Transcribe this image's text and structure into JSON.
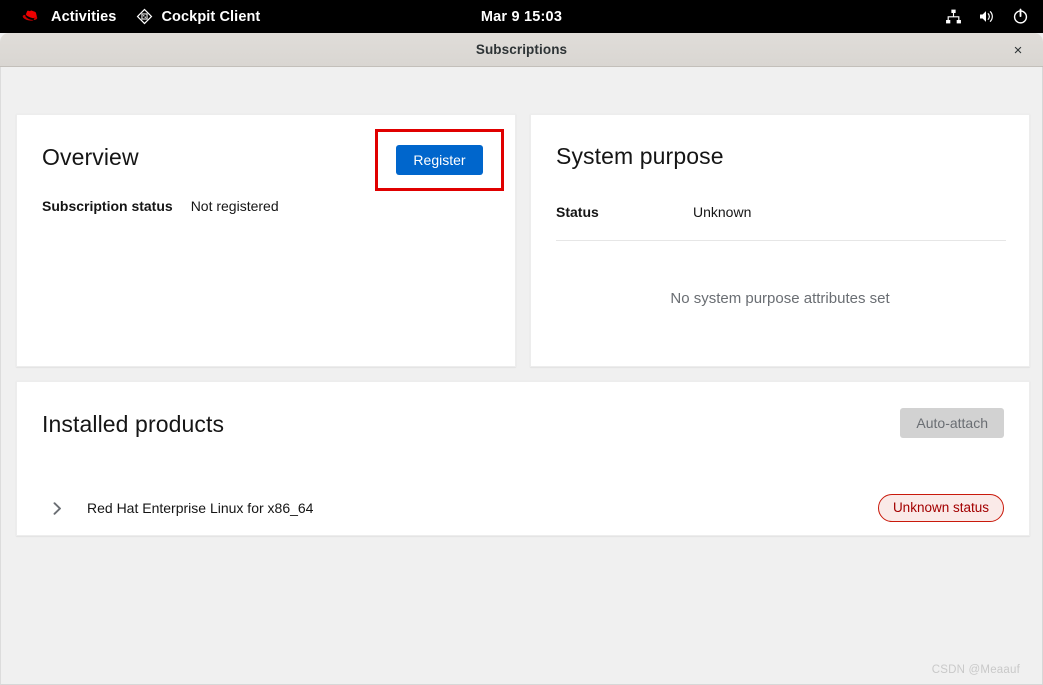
{
  "topbar": {
    "activities_label": "Activities",
    "activities_icon": "red-hat-logo-icon",
    "app_label": "Cockpit Client",
    "app_icon": "cockpit-logo-icon",
    "clock": "Mar 9  15:03",
    "tray": [
      {
        "name": "network-icon"
      },
      {
        "name": "volume-icon"
      },
      {
        "name": "power-icon"
      }
    ]
  },
  "window": {
    "title": "Subscriptions",
    "close_label": "×"
  },
  "overview": {
    "title": "Overview",
    "status_label": "Subscription status",
    "status_value": "Not registered",
    "register_label": "Register",
    "highlight_color": "#e00000",
    "primary_color": "#0066cc"
  },
  "system_purpose": {
    "title": "System purpose",
    "status_label": "Status",
    "status_value": "Unknown",
    "empty_text": "No system purpose attributes set"
  },
  "installed_products": {
    "title": "Installed products",
    "auto_attach_label": "Auto-attach",
    "rows": [
      {
        "expand_icon": "chevron-right-icon",
        "name": "Red Hat Enterprise Linux for x86_64",
        "status": "Unknown status",
        "status_color": "#c9190b"
      }
    ]
  },
  "watermark": "CSDN @Meaauf"
}
